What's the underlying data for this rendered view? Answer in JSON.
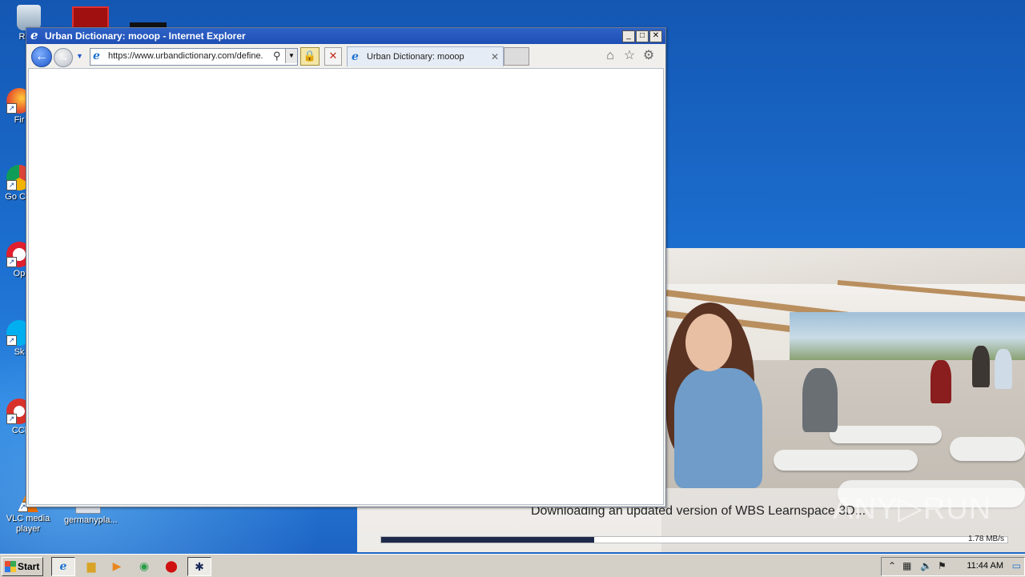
{
  "desktop": {
    "icons": [
      {
        "label": "Recy",
        "name": "recycle-bin"
      },
      {
        "label": "Fir",
        "name": "firefox"
      },
      {
        "label": "Go Chr",
        "name": "google-chrome"
      },
      {
        "label": "Op",
        "name": "opera"
      },
      {
        "label": "Sk",
        "name": "skype"
      },
      {
        "label": "CCl",
        "name": "ccleaner"
      },
      {
        "label": "VLC media player",
        "name": "vlc-media-player"
      },
      {
        "label": "germanypla...",
        "name": "germany-file"
      }
    ]
  },
  "splash": {
    "message": "Downloading an updated version of WBS Learnspace 3D...",
    "progress_fraction": 0.34,
    "speed": "1.78 MB/s"
  },
  "watermark": {
    "left": "ANY",
    "right": "RUN"
  },
  "browser": {
    "title": "Urban Dictionary: mooop - Internet Explorer",
    "url": "https://www.urbandictionary.com/define.",
    "tab_label": "Urban Dictionary: mooop",
    "win_buttons": {
      "minimize": "_",
      "maximize": "□",
      "close": "✕"
    }
  },
  "taskbar": {
    "start_label": "Start",
    "clock": "11:44 AM"
  },
  "colors": {
    "titlebar": "#2f62c7",
    "desktop": "#1c6fd0",
    "progress": "#1e2a4a"
  }
}
